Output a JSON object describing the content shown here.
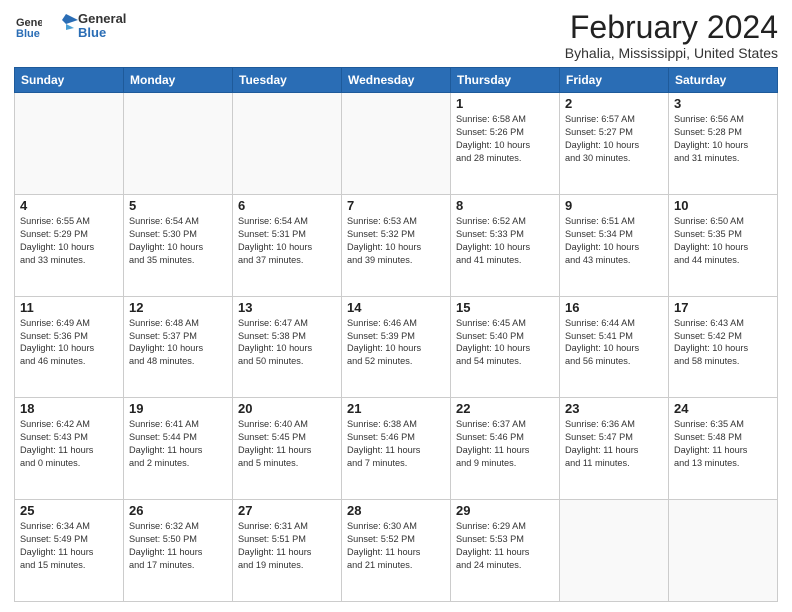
{
  "header": {
    "logo": {
      "general": "General",
      "blue": "Blue"
    },
    "title": "February 2024",
    "location": "Byhalia, Mississippi, United States"
  },
  "weekdays": [
    "Sunday",
    "Monday",
    "Tuesday",
    "Wednesday",
    "Thursday",
    "Friday",
    "Saturday"
  ],
  "weeks": [
    [
      {
        "day": "",
        "info": ""
      },
      {
        "day": "",
        "info": ""
      },
      {
        "day": "",
        "info": ""
      },
      {
        "day": "",
        "info": ""
      },
      {
        "day": "1",
        "info": "Sunrise: 6:58 AM\nSunset: 5:26 PM\nDaylight: 10 hours\nand 28 minutes."
      },
      {
        "day": "2",
        "info": "Sunrise: 6:57 AM\nSunset: 5:27 PM\nDaylight: 10 hours\nand 30 minutes."
      },
      {
        "day": "3",
        "info": "Sunrise: 6:56 AM\nSunset: 5:28 PM\nDaylight: 10 hours\nand 31 minutes."
      }
    ],
    [
      {
        "day": "4",
        "info": "Sunrise: 6:55 AM\nSunset: 5:29 PM\nDaylight: 10 hours\nand 33 minutes."
      },
      {
        "day": "5",
        "info": "Sunrise: 6:54 AM\nSunset: 5:30 PM\nDaylight: 10 hours\nand 35 minutes."
      },
      {
        "day": "6",
        "info": "Sunrise: 6:54 AM\nSunset: 5:31 PM\nDaylight: 10 hours\nand 37 minutes."
      },
      {
        "day": "7",
        "info": "Sunrise: 6:53 AM\nSunset: 5:32 PM\nDaylight: 10 hours\nand 39 minutes."
      },
      {
        "day": "8",
        "info": "Sunrise: 6:52 AM\nSunset: 5:33 PM\nDaylight: 10 hours\nand 41 minutes."
      },
      {
        "day": "9",
        "info": "Sunrise: 6:51 AM\nSunset: 5:34 PM\nDaylight: 10 hours\nand 43 minutes."
      },
      {
        "day": "10",
        "info": "Sunrise: 6:50 AM\nSunset: 5:35 PM\nDaylight: 10 hours\nand 44 minutes."
      }
    ],
    [
      {
        "day": "11",
        "info": "Sunrise: 6:49 AM\nSunset: 5:36 PM\nDaylight: 10 hours\nand 46 minutes."
      },
      {
        "day": "12",
        "info": "Sunrise: 6:48 AM\nSunset: 5:37 PM\nDaylight: 10 hours\nand 48 minutes."
      },
      {
        "day": "13",
        "info": "Sunrise: 6:47 AM\nSunset: 5:38 PM\nDaylight: 10 hours\nand 50 minutes."
      },
      {
        "day": "14",
        "info": "Sunrise: 6:46 AM\nSunset: 5:39 PM\nDaylight: 10 hours\nand 52 minutes."
      },
      {
        "day": "15",
        "info": "Sunrise: 6:45 AM\nSunset: 5:40 PM\nDaylight: 10 hours\nand 54 minutes."
      },
      {
        "day": "16",
        "info": "Sunrise: 6:44 AM\nSunset: 5:41 PM\nDaylight: 10 hours\nand 56 minutes."
      },
      {
        "day": "17",
        "info": "Sunrise: 6:43 AM\nSunset: 5:42 PM\nDaylight: 10 hours\nand 58 minutes."
      }
    ],
    [
      {
        "day": "18",
        "info": "Sunrise: 6:42 AM\nSunset: 5:43 PM\nDaylight: 11 hours\nand 0 minutes."
      },
      {
        "day": "19",
        "info": "Sunrise: 6:41 AM\nSunset: 5:44 PM\nDaylight: 11 hours\nand 2 minutes."
      },
      {
        "day": "20",
        "info": "Sunrise: 6:40 AM\nSunset: 5:45 PM\nDaylight: 11 hours\nand 5 minutes."
      },
      {
        "day": "21",
        "info": "Sunrise: 6:38 AM\nSunset: 5:46 PM\nDaylight: 11 hours\nand 7 minutes."
      },
      {
        "day": "22",
        "info": "Sunrise: 6:37 AM\nSunset: 5:46 PM\nDaylight: 11 hours\nand 9 minutes."
      },
      {
        "day": "23",
        "info": "Sunrise: 6:36 AM\nSunset: 5:47 PM\nDaylight: 11 hours\nand 11 minutes."
      },
      {
        "day": "24",
        "info": "Sunrise: 6:35 AM\nSunset: 5:48 PM\nDaylight: 11 hours\nand 13 minutes."
      }
    ],
    [
      {
        "day": "25",
        "info": "Sunrise: 6:34 AM\nSunset: 5:49 PM\nDaylight: 11 hours\nand 15 minutes."
      },
      {
        "day": "26",
        "info": "Sunrise: 6:32 AM\nSunset: 5:50 PM\nDaylight: 11 hours\nand 17 minutes."
      },
      {
        "day": "27",
        "info": "Sunrise: 6:31 AM\nSunset: 5:51 PM\nDaylight: 11 hours\nand 19 minutes."
      },
      {
        "day": "28",
        "info": "Sunrise: 6:30 AM\nSunset: 5:52 PM\nDaylight: 11 hours\nand 21 minutes."
      },
      {
        "day": "29",
        "info": "Sunrise: 6:29 AM\nSunset: 5:53 PM\nDaylight: 11 hours\nand 24 minutes."
      },
      {
        "day": "",
        "info": ""
      },
      {
        "day": "",
        "info": ""
      }
    ]
  ]
}
